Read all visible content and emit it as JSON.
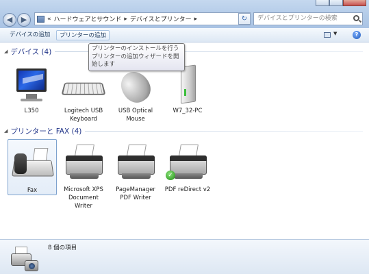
{
  "window": {
    "breadcrumb_prefix": "«",
    "breadcrumb": [
      "ハードウェアとサウンド",
      "デバイスとプリンター"
    ],
    "search_placeholder": "デバイスとプリンターの検索"
  },
  "toolbar": {
    "add_device": "デバイスの追加",
    "add_printer": "プリンターの追加"
  },
  "tooltip": "プリンターのインストールを行うプリンターの追加ウィザードを開始します",
  "groups": [
    {
      "title": "デバイス (4)",
      "items": [
        {
          "label": "L350",
          "icon": "monitor-icon"
        },
        {
          "label": "Logitech USB Keyboard",
          "icon": "keyboard-icon"
        },
        {
          "label": "USB Optical Mouse",
          "icon": "mouse-icon"
        },
        {
          "label": "W7_32-PC",
          "icon": "computer-icon"
        }
      ]
    },
    {
      "title": "プリンターと FAX (4)",
      "items": [
        {
          "label": "Fax",
          "icon": "fax-icon"
        },
        {
          "label": "Microsoft XPS Document Writer",
          "icon": "printer-icon"
        },
        {
          "label": "PageManager PDF Writer",
          "icon": "printer-icon"
        },
        {
          "label": "PDF reDirect v2",
          "icon": "printer-icon",
          "default": true
        }
      ]
    }
  ],
  "details": {
    "count": "8 個の項目"
  }
}
